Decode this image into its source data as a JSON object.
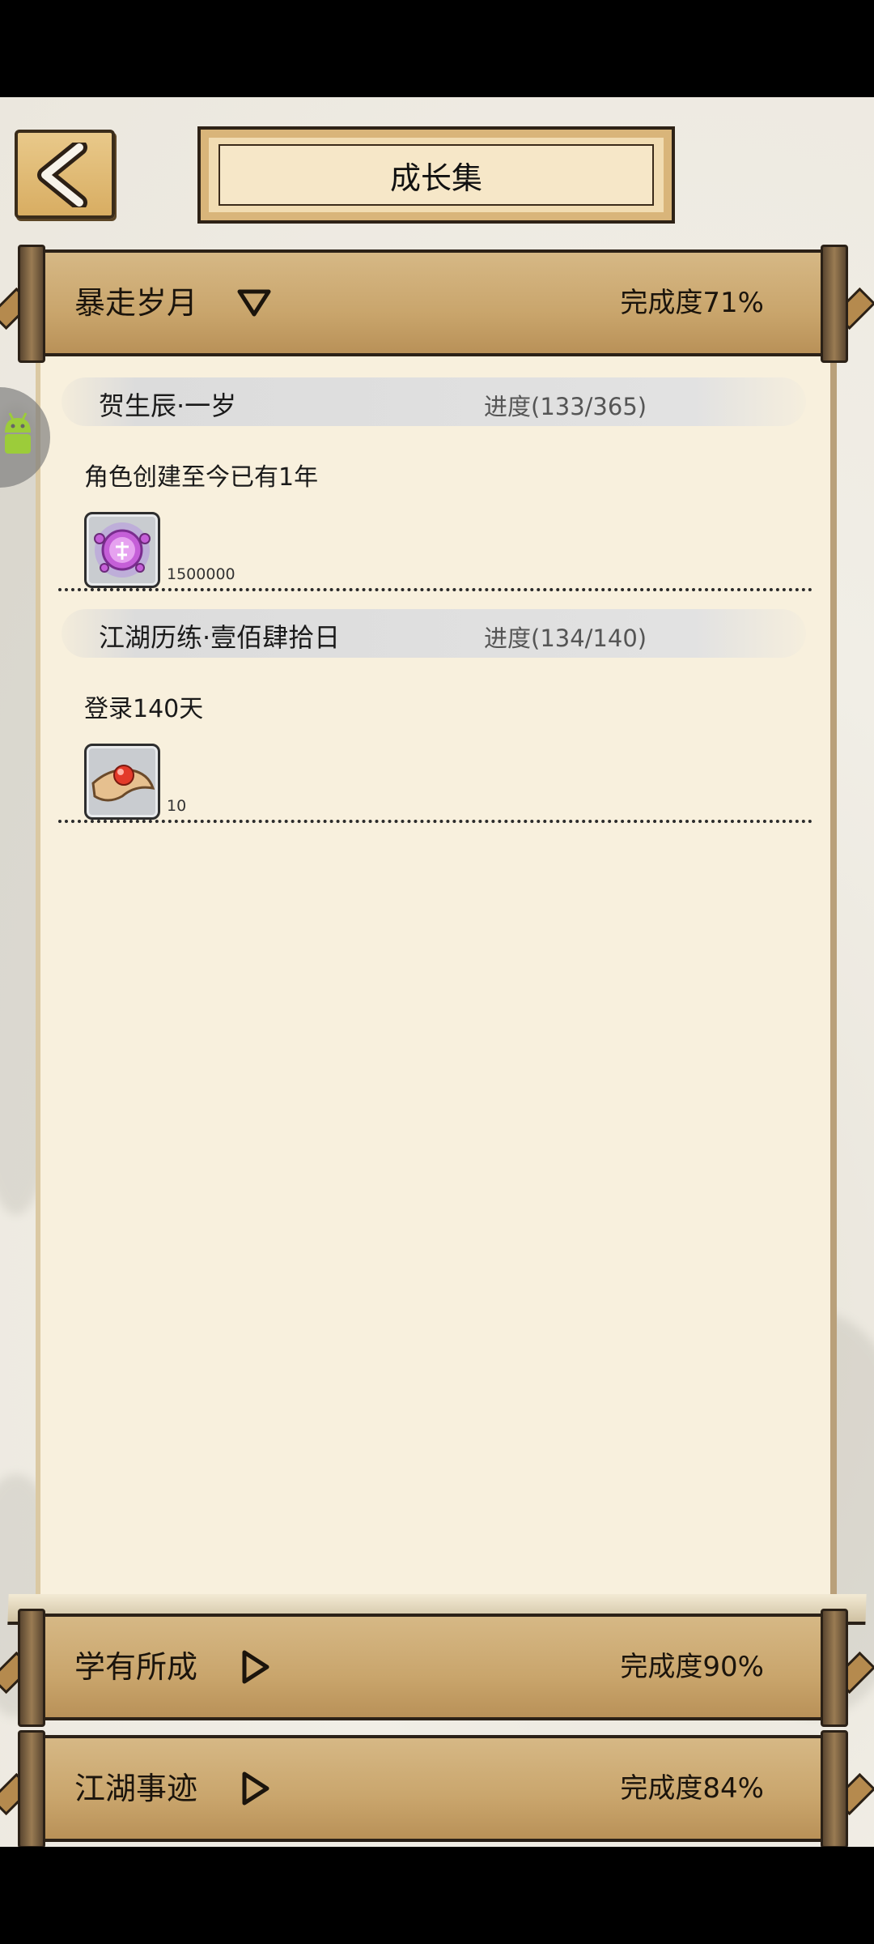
{
  "header": {
    "title": "成长集"
  },
  "sections": [
    {
      "name": "暴走岁月",
      "completion": "完成度71%",
      "expanded": true,
      "items": [
        {
          "title": "贺生辰·一岁",
          "progress": "进度(133/365)",
          "description": "角色创建至今已有1年",
          "reward_icon": "purple-orb-icon",
          "reward_count": "1500000"
        },
        {
          "title": "江湖历练·壹佰肆拾日",
          "progress": "进度(134/140)",
          "description": "登录140天",
          "reward_icon": "red-pearl-icon",
          "reward_count": "10"
        }
      ]
    },
    {
      "name": "学有所成",
      "completion": "完成度90%",
      "expanded": false
    },
    {
      "name": "江湖事迹",
      "completion": "完成度84%",
      "expanded": false
    }
  ],
  "colors": {
    "parchment": "#f8f0dd",
    "bar_gold": "#c9a56c",
    "ink_dark": "#2b2117"
  }
}
